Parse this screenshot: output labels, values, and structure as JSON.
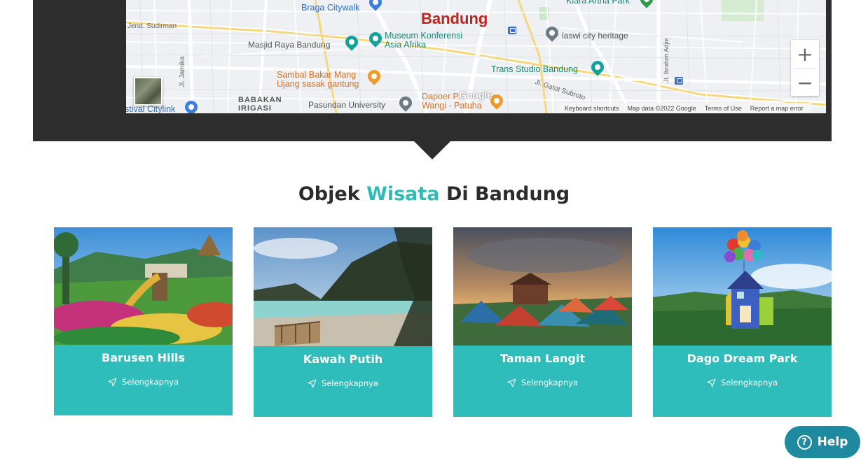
{
  "map": {
    "city_label": "Bandung",
    "places": {
      "braga": "Braga Citywalk",
      "kiara": "Kiara Artha Park",
      "museum": "Museum Konferensi\nAsia Afrika",
      "laswi": "laswi city heritage",
      "masjid": "Masjid Raya Bandung",
      "sambal": "Sambal Bakar Mang\nUjang sasak gantung",
      "trans_studio": "Trans Studio Bandung",
      "pasundan": "Pasundan University",
      "dapoer": "Dapoer P...\nWangi - Patuha",
      "citylink": "stival Citylink",
      "babakan": "BABAKAN\nIRIGASI"
    },
    "streets": {
      "sudirman": "Jend. Sudirman",
      "jamika": "Jl. Jamika",
      "gatot": "Jl. Gatot Subroto",
      "ibrahim": "Jl. Ibrahim Adjie"
    },
    "google_logo": "Google",
    "attribution": [
      "Keyboard shortcuts",
      "Map data ©2022 Google",
      "Terms of Use",
      "Report a map error"
    ],
    "zoom_in": "+",
    "zoom_out": "−"
  },
  "section": {
    "title_part1": "Objek",
    "title_accent": "Wisata",
    "title_part2": "Di Bandung"
  },
  "cards": [
    {
      "name": "Barusen Hills",
      "link": "Selengkapnya"
    },
    {
      "name": "Kawah Putih",
      "link": "Selengkapnya"
    },
    {
      "name": "Taman Langit",
      "link": "Selengkapnya"
    },
    {
      "name": "Dago Dream Park",
      "link": "Selengkapnya"
    }
  ],
  "help": {
    "label": "Help",
    "icon": "?"
  },
  "colors": {
    "accent": "#2ebdba",
    "dark_band": "#2d2d2d",
    "help": "#1d8aa0",
    "city": "#c0221c"
  }
}
